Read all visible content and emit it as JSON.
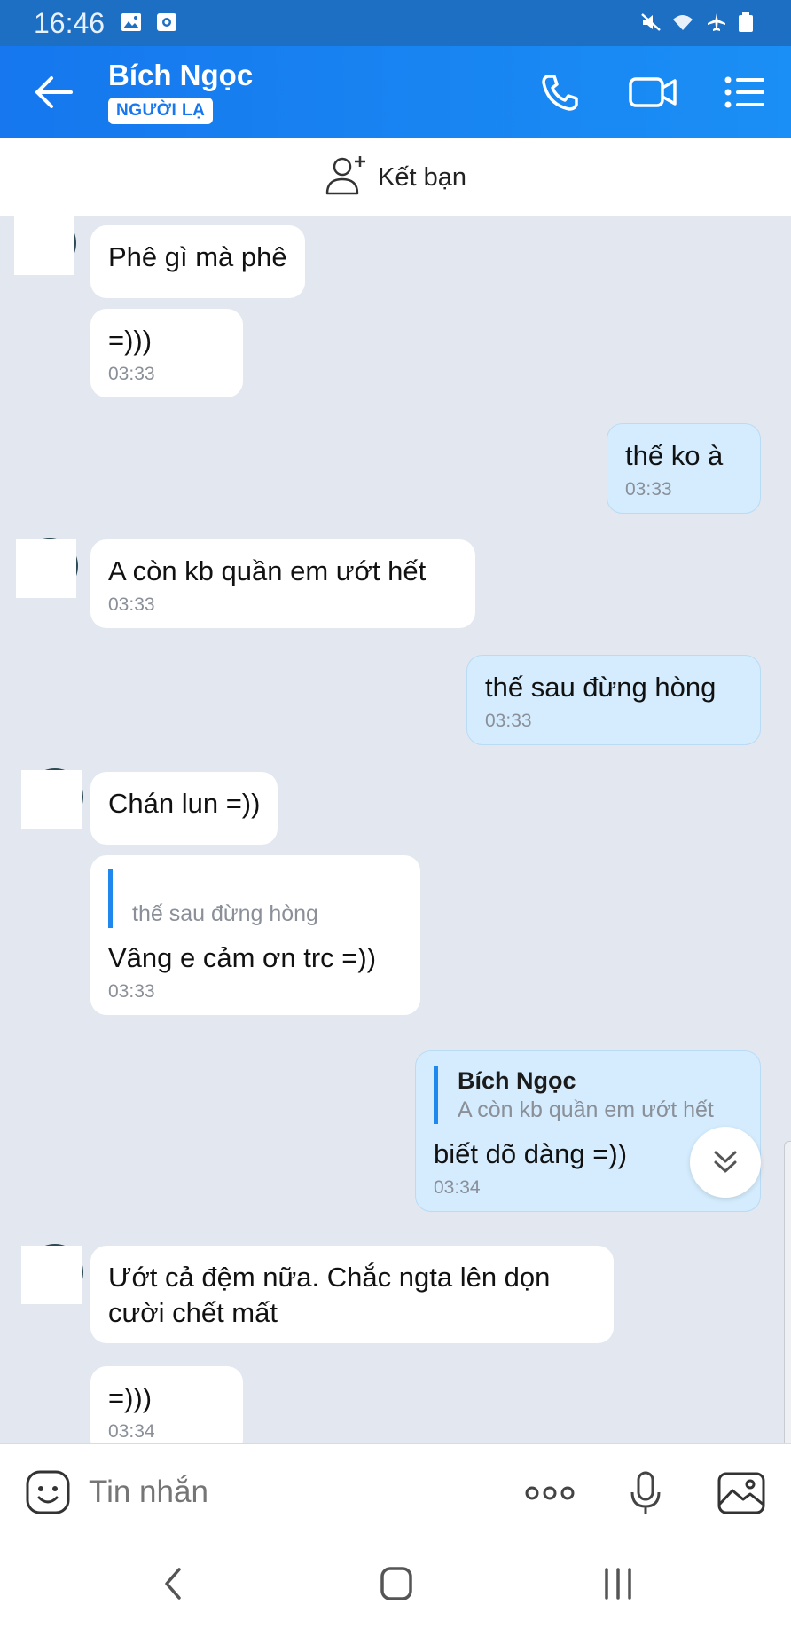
{
  "status_bar": {
    "time": "16:46"
  },
  "header": {
    "contact_name": "Bích Ngọc",
    "badge": "NGƯỜI LẠ"
  },
  "add_friend": {
    "label": "Kết bạn"
  },
  "messages": [
    {
      "dir": "in",
      "text": "Phê gì mà phê",
      "time": ""
    },
    {
      "dir": "in",
      "text": "=)))",
      "time": "03:33"
    },
    {
      "dir": "out",
      "text": "thế ko à",
      "time": "03:33"
    },
    {
      "dir": "in",
      "text": "A còn kb quần em ướt hết",
      "time": "03:33"
    },
    {
      "dir": "out",
      "text": "thế sau đừng hòng",
      "time": "03:33"
    },
    {
      "dir": "in",
      "text": "Chán lun =))",
      "time": ""
    },
    {
      "dir": "in",
      "text": "Vâng e cảm ơn trc =))",
      "time": "03:33",
      "quote_text": "thế sau đừng hòng"
    },
    {
      "dir": "out",
      "text": "biết dõ dàng =))",
      "time": "03:34",
      "quote_author": "Bích Ngọc",
      "quote_text": "A còn kb quần em ướt hết"
    },
    {
      "dir": "in",
      "text_line1": "Ướt cả đệm nữa. Chắc ngta lên dọn",
      "text_line2": "cười chết mất",
      "time": ""
    },
    {
      "dir": "in",
      "text": "=)))",
      "time": "03:34"
    }
  ],
  "input": {
    "placeholder": "Tin nhắn"
  },
  "colors": {
    "header": "#1677ee",
    "outgoing_bubble": "#d4ecfd",
    "chat_bg": "#e3e7ef",
    "quote_bar": "#1e88ee"
  }
}
